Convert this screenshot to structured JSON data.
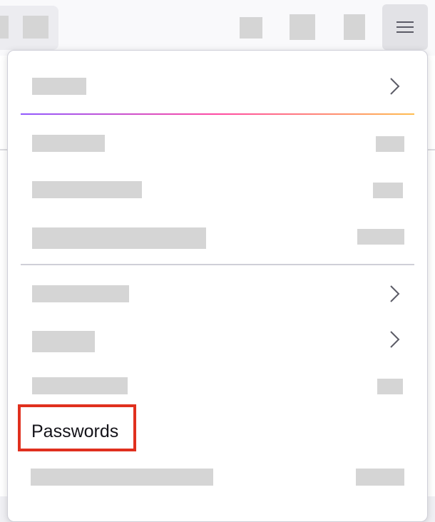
{
  "toolbar": {
    "menu_button_icon": "hamburger-menu-icon"
  },
  "menu": {
    "items": [
      {
        "label": "",
        "has_submenu": true
      },
      {
        "label": "",
        "shortcut": ""
      },
      {
        "label": "",
        "shortcut": ""
      },
      {
        "label": "",
        "shortcut": ""
      },
      {
        "label": "",
        "has_submenu": true
      },
      {
        "label": "",
        "has_submenu": true
      },
      {
        "label": "",
        "shortcut": ""
      },
      {
        "label": "Passwords"
      },
      {
        "label": "",
        "shortcut": ""
      }
    ]
  },
  "colors": {
    "highlight": "#e0301e",
    "separator_gradient": [
      "#9059ff",
      "#ff4aa2",
      "#ffbd4f"
    ]
  }
}
